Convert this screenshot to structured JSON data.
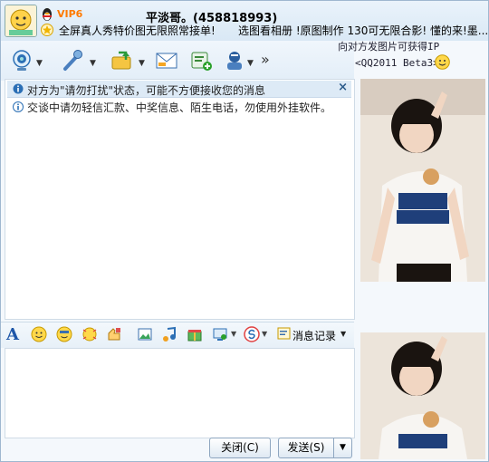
{
  "header": {
    "vip": "VIP6",
    "contact_name": "平淡哥。(458818993)",
    "signature": "全屏真人秀特价图无限照常接单!",
    "signature_right": "选图看相册 !原图制作 130可无限合影! 懂的来!墨..."
  },
  "toolbar": {
    "more": "»",
    "ip_line1": "向对方发图片可获得IP",
    "ip_line2": "<QQ2011 Beta3>"
  },
  "chat": {
    "notice_dnd": "对方为\"请勿打扰\"状态，可能不方便接收您的消息",
    "notice_dnd_close": "×",
    "notice_safety": "交谈中请勿轻信汇款、中奖信息、陌生电话，勿使用外挂软件。"
  },
  "emotion_bar": {
    "font_label": "A",
    "history_label": "消息记录"
  },
  "buttons": {
    "close_label": "关闭(C)",
    "send_label": "发送(S)",
    "send_menu": "▼"
  },
  "colors": {
    "accent": "#1d56a8",
    "notice_bg": "#ddeaf6",
    "vip": "#ff7a00"
  }
}
